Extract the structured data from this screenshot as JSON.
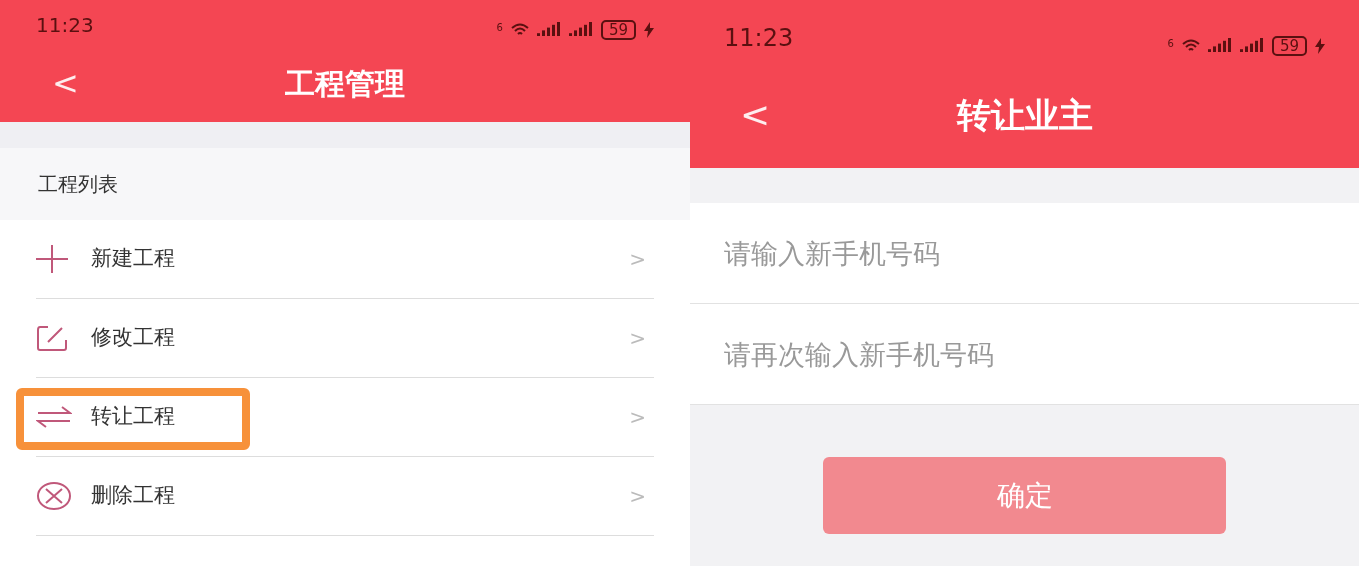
{
  "screens": [
    {
      "status_bar": {
        "time": "11:23",
        "wifi_badge": "6",
        "battery": "59",
        "charging": true
      },
      "header": {
        "back": "<",
        "title": "工程管理"
      },
      "section_title": "工程列表",
      "menu": [
        {
          "kind": "plus",
          "label": "新建工程",
          "chevron": ">",
          "highlighted": false
        },
        {
          "kind": "edit",
          "label": "修改工程",
          "chevron": ">",
          "highlighted": false
        },
        {
          "kind": "swap",
          "label": "转让工程",
          "chevron": ">",
          "highlighted": true
        },
        {
          "kind": "delete",
          "label": "删除工程",
          "chevron": ">",
          "highlighted": false
        }
      ]
    },
    {
      "status_bar": {
        "time": "11:23",
        "wifi_badge": "6",
        "battery": "59",
        "charging": true
      },
      "header": {
        "back": "<",
        "title": "转让业主"
      },
      "fields": [
        {
          "placeholder": "请输入新手机号码"
        },
        {
          "placeholder": "请再次输入新手机号码"
        }
      ],
      "confirm_button": {
        "label": "确定",
        "disabled": true
      }
    }
  ]
}
